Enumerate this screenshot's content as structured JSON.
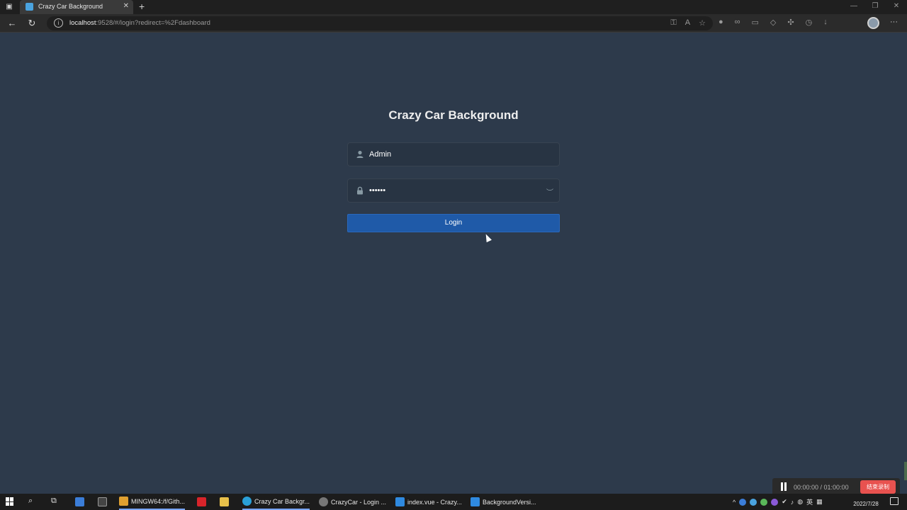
{
  "browser": {
    "tab_title": "Crazy Car Background",
    "url_host": "localhost",
    "url_rest": ":9528/#/login?redirect=%2Fdashboard"
  },
  "page": {
    "title": "Crazy Car Background",
    "username_value": "Admin",
    "password_value": "••••••",
    "login_label": "Login"
  },
  "recorder": {
    "time": "00:00:00 / 01:00:00",
    "stop_label": "结束录制"
  },
  "taskbar": {
    "apps": [
      {
        "label": ""
      },
      {
        "label": ""
      },
      {
        "label": "MINGW64:/f/Gith..."
      },
      {
        "label": ""
      },
      {
        "label": ""
      },
      {
        "label": "Crazy Car Backgr..."
      },
      {
        "label": "CrazyCar - Login ..."
      },
      {
        "label": "index.vue - Crazy..."
      },
      {
        "label": "BackgroundVersi..."
      }
    ],
    "ime": "英",
    "date": "2022/7/28"
  },
  "colors": {
    "page_bg": "#2d3a4b",
    "button_bg": "#1f5aa8",
    "input_bg": "#283443"
  }
}
